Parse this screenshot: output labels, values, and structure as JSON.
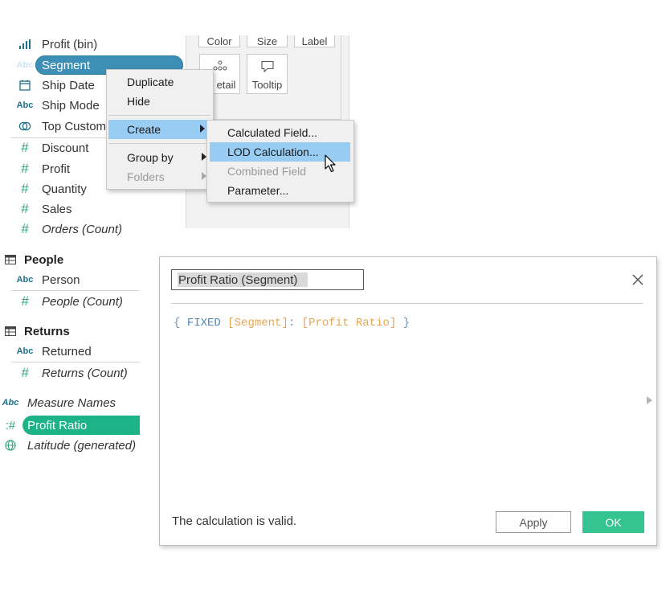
{
  "data_pane": {
    "fields": [
      {
        "label": "Profit (bin)",
        "icon": "bin-bar-icon"
      },
      {
        "label": "Segment",
        "icon": "dimension-abc-icon"
      },
      {
        "label": "Ship Date",
        "icon": "calendar-icon"
      },
      {
        "label": "Ship Mode",
        "icon": "dimension-abc-icon"
      },
      {
        "label": "Top Custom",
        "icon": "set-icon"
      },
      {
        "label": "Discount",
        "icon": "measure-hash-icon"
      },
      {
        "label": "Profit",
        "icon": "measure-hash-icon"
      },
      {
        "label": "Quantity",
        "icon": "measure-hash-icon"
      },
      {
        "label": "Sales",
        "icon": "measure-hash-icon"
      },
      {
        "label": "Orders (Count)",
        "icon": "measure-hash-icon"
      }
    ],
    "abc": "Abc",
    "people": {
      "title": "People",
      "fields": [
        "Person",
        "People (Count)"
      ]
    },
    "returns": {
      "title": "Returns",
      "fields": [
        "Returned",
        "Returns (Count)"
      ]
    },
    "measure_names": "Measure Names",
    "profit_ratio": "Profit Ratio",
    "latitude": "Latitude (generated)"
  },
  "marks_card": {
    "color": "Color",
    "size": "Size",
    "label": "Label",
    "detail": "etail",
    "tooltip": "Tooltip"
  },
  "context_menu": {
    "items": [
      "Duplicate",
      "Hide",
      "Create",
      "Group by",
      "Folders"
    ]
  },
  "create_submenu": {
    "items": [
      "Calculated Field...",
      "LOD Calculation...",
      "Combined Field",
      "Parameter..."
    ]
  },
  "dialog": {
    "name_value": "Profit Ratio (Segment)",
    "formula": {
      "open_brace": "{",
      "keyword": "FIXED",
      "dimension": "[Segment]",
      "colon": ":",
      "measure": "[Profit Ratio]",
      "close_brace": "}"
    },
    "status": "The calculation is valid.",
    "apply_label": "Apply",
    "ok_label": "OK"
  },
  "colors": {
    "selection_blue": "#3d8fb5",
    "menu_highlight": "#99ccf3",
    "measure_green": "#1cb386",
    "ok_green": "#35c392",
    "formula_field": "#e6a553"
  }
}
